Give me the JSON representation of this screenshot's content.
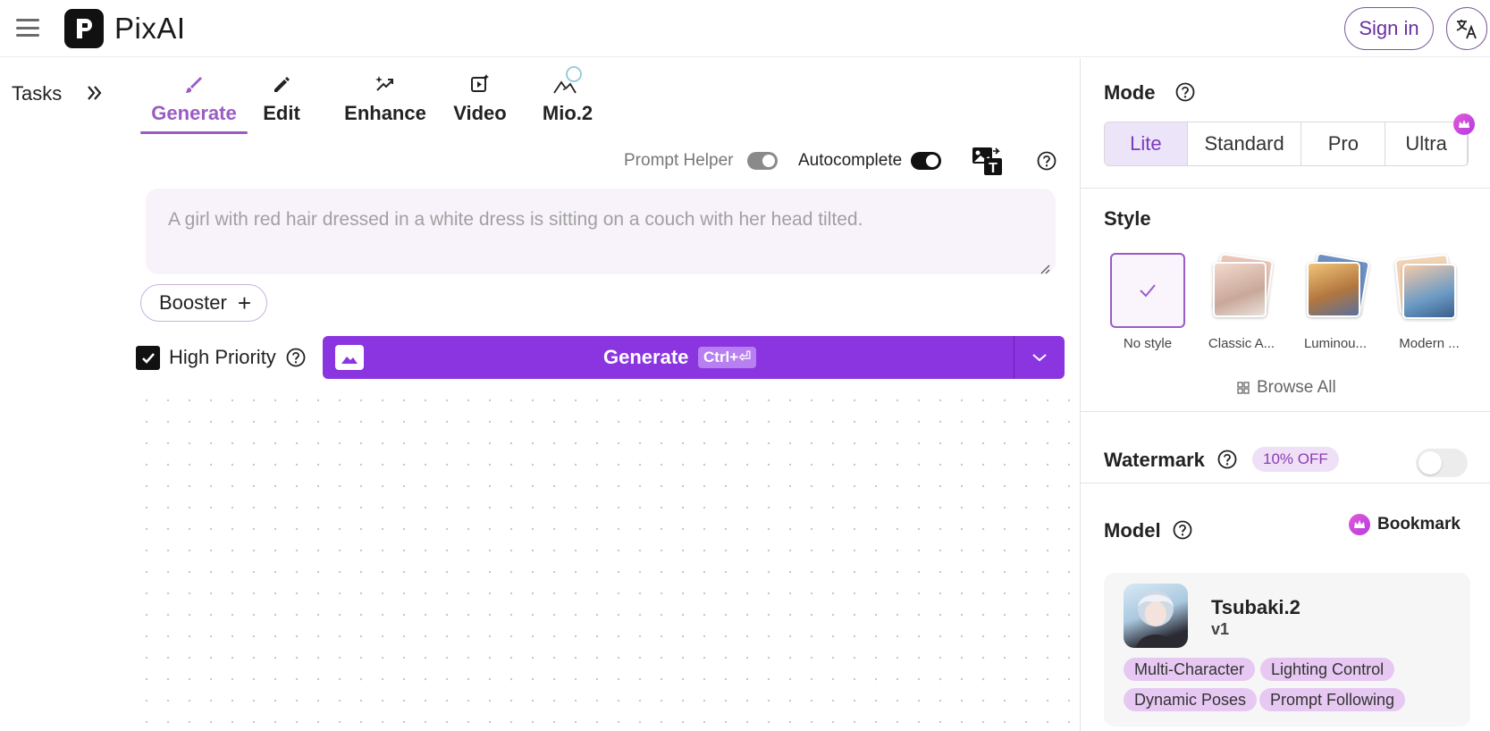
{
  "header": {
    "logo_text": "PixAI",
    "signin_label": "Sign in",
    "menu_icon": "hamburger-menu-icon",
    "language_icon": "translate-icon"
  },
  "sidebar": {
    "tasks_label": "Tasks",
    "expand_icon": "double-chevron-right-icon"
  },
  "tabs": [
    {
      "label": "Generate",
      "icon": "brush-icon",
      "active": true
    },
    {
      "label": "Edit",
      "icon": "pencil-icon",
      "active": false
    },
    {
      "label": "Enhance",
      "icon": "sparkle-enhance-icon",
      "active": false
    },
    {
      "label": "Video",
      "icon": "video-sparkle-icon",
      "active": false
    },
    {
      "label": "Mio.2",
      "icon": "mio-icon",
      "active": false
    }
  ],
  "helper": {
    "prompt_helper_label": "Prompt Helper",
    "prompt_helper_on": false,
    "autocomplete_label": "Autocomplete",
    "autocomplete_on": true
  },
  "prompt": {
    "placeholder": "A girl with red hair dressed in a white dress is sitting on a couch with her head tilted."
  },
  "booster": {
    "label": "Booster",
    "plus": "+"
  },
  "priority": {
    "label": "High Priority",
    "checked": true
  },
  "generate": {
    "label": "Generate",
    "shortcut": "Ctrl+⏎"
  },
  "panel": {
    "mode": {
      "title": "Mode",
      "options": [
        "Lite",
        "Standard",
        "Pro",
        "Ultra"
      ],
      "selected": "Lite"
    },
    "style": {
      "title": "Style",
      "items": [
        {
          "name": "No style",
          "selected": true
        },
        {
          "name": "Classic A...",
          "selected": false
        },
        {
          "name": "Luminou...",
          "selected": false
        },
        {
          "name": "Modern ...",
          "selected": false
        }
      ],
      "browse_all": "Browse All"
    },
    "watermark": {
      "title": "Watermark",
      "badge": "10% OFF",
      "enabled": false
    },
    "model": {
      "title": "Model",
      "bookmark_label": "Bookmark",
      "name": "Tsubaki.2",
      "version": "v1",
      "tags": [
        "Multi-Character",
        "Lighting Control",
        "Dynamic Poses",
        "Prompt Following"
      ]
    }
  },
  "colors": {
    "accent": "#8a35e0",
    "accent_light": "#9a5cc4",
    "tag_bg": "#e7c8f3"
  }
}
